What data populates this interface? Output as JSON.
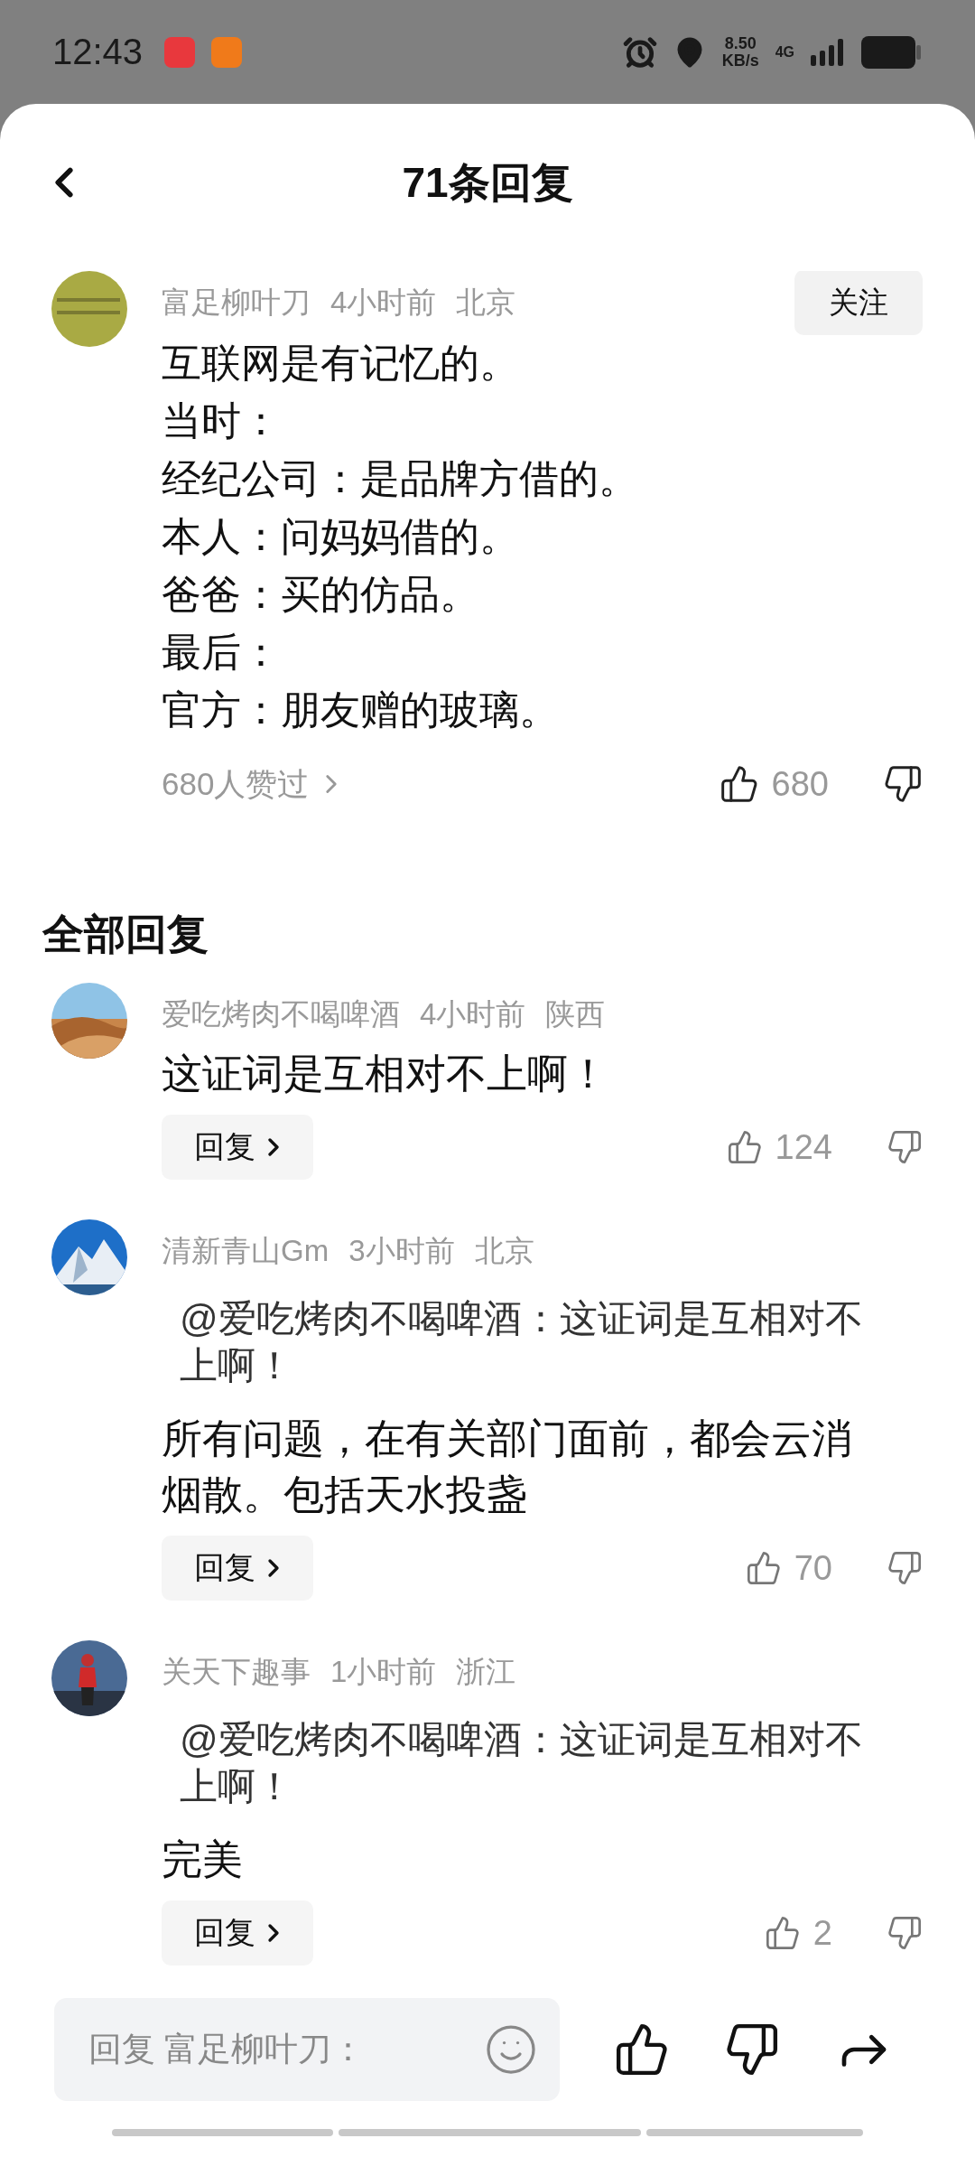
{
  "status_bar": {
    "time": "12:43",
    "speed_value": "8.50",
    "speed_unit": "KB/s",
    "network": "4G"
  },
  "header": {
    "title": "71条回复"
  },
  "main_comment": {
    "author": "富足柳叶刀",
    "time": "4小时前",
    "location": "北京",
    "follow_label": "关注",
    "lines": [
      "互联网是有记忆的。",
      "当时：",
      "经纪公司：是品牌方借的。",
      "本人：问妈妈借的。",
      "爸爸：买的仿品。",
      "最后：",
      "官方：朋友赠的玻璃。"
    ],
    "likers": "680人赞过",
    "like_count": "680"
  },
  "section_title": "全部回复",
  "replies": [
    {
      "author": "爱吃烤肉不喝啤酒",
      "time": "4小时前",
      "location": "陕西",
      "text": "这证词是互相对不上啊！",
      "reply_label": "回复",
      "like_count": "124"
    },
    {
      "author": "清新青山Gm",
      "time": "3小时前",
      "location": "北京",
      "quote": "@爱吃烤肉不喝啤酒：这证词是互相对不上啊！",
      "text": "所有问题，在有关部门面前，都会云消烟散。包括天水投盏",
      "reply_label": "回复",
      "like_count": "70"
    },
    {
      "author": "关天下趣事",
      "time": "1小时前",
      "location": "浙江",
      "quote": "@爱吃烤肉不喝啤酒：这证词是互相对不上啊！",
      "text": "完美",
      "reply_label": "回复",
      "like_count": "2"
    }
  ],
  "input": {
    "placeholder": "回复 富足柳叶刀："
  }
}
